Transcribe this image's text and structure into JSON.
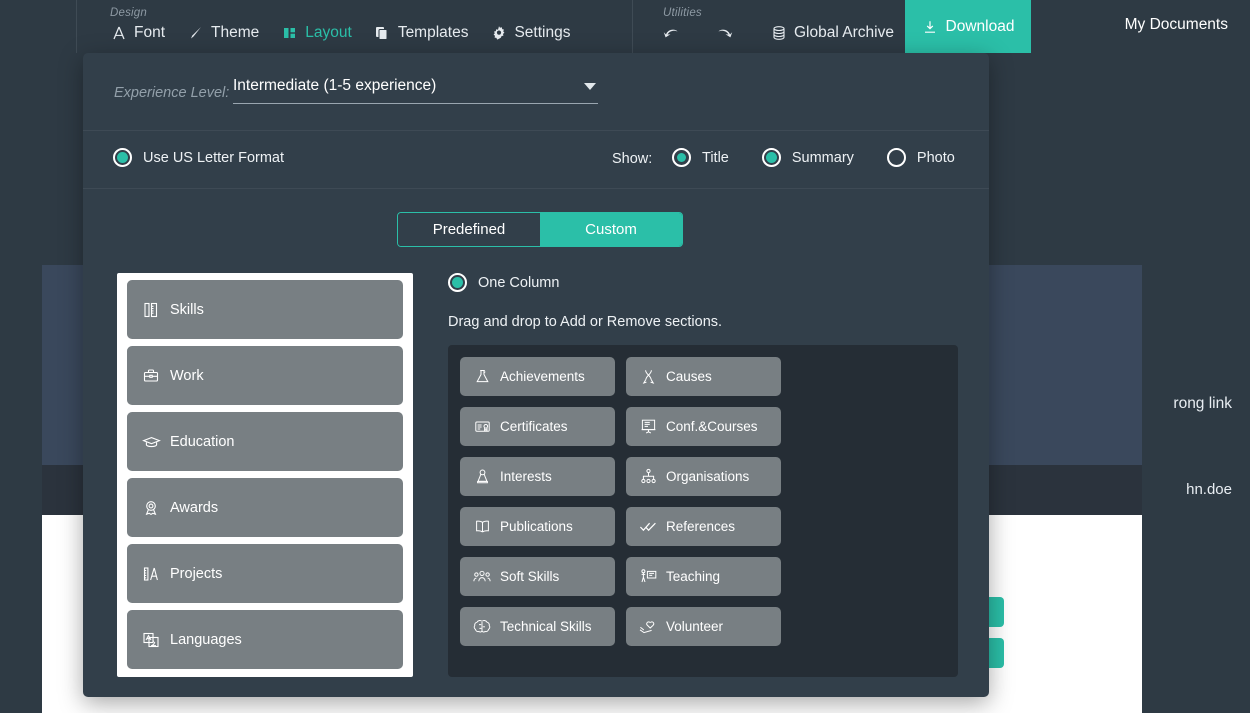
{
  "toolbar": {
    "groups": [
      {
        "label": "Design",
        "items": [
          {
            "label": "Font",
            "icon": "font-icon",
            "active": false
          },
          {
            "label": "Theme",
            "icon": "brush-icon",
            "active": false
          },
          {
            "label": "Layout",
            "icon": "layout-icon",
            "active": true
          },
          {
            "label": "Templates",
            "icon": "templates-icon",
            "active": false
          },
          {
            "label": "Settings",
            "icon": "gear-icon",
            "active": false
          }
        ]
      },
      {
        "label": "Utilities",
        "items": [
          {
            "label": "",
            "icon": "undo-icon",
            "active": false
          },
          {
            "label": "",
            "icon": "redo-icon",
            "active": false
          },
          {
            "label": "Global Archive",
            "icon": "database-icon",
            "active": false
          }
        ]
      }
    ],
    "download_label": "Download",
    "download_icon": "download-icon",
    "my_documents_label": "My Documents",
    "accent_color": "#2bbfa8"
  },
  "modal": {
    "experience": {
      "label": "Experience Level:",
      "value": "Intermediate (1-5 experience)"
    },
    "us_letter": {
      "label": "Use US Letter Format",
      "selected": true
    },
    "show": {
      "label": "Show:",
      "options": [
        {
          "label": "Title",
          "selected": true,
          "style": "gap"
        },
        {
          "label": "Summary",
          "selected": true,
          "style": "full"
        },
        {
          "label": "Photo",
          "selected": false,
          "style": "off"
        }
      ]
    },
    "tabs": [
      {
        "label": "Predefined",
        "active": false
      },
      {
        "label": "Custom",
        "active": true
      }
    ],
    "column_option": {
      "label": "One Column",
      "selected": true
    },
    "drag_hint": "Drag and drop to Add or Remove sections.",
    "active_sections": [
      {
        "label": "Skills",
        "icon": "skills-icon"
      },
      {
        "label": "Work",
        "icon": "briefcase-icon"
      },
      {
        "label": "Education",
        "icon": "graduation-cap-icon"
      },
      {
        "label": "Awards",
        "icon": "award-rosette-icon"
      },
      {
        "label": "Projects",
        "icon": "projects-icon"
      },
      {
        "label": "Languages",
        "icon": "translate-icon"
      }
    ],
    "available_sections": [
      {
        "label": "Achievements",
        "icon": "flask-icon"
      },
      {
        "label": "Causes",
        "icon": "ribbon-icon"
      },
      {
        "label": "Certificates",
        "icon": "certificate-icon"
      },
      {
        "label": "Conf.&Courses",
        "icon": "presentation-icon"
      },
      {
        "label": "Interests",
        "icon": "chess-pawn-icon"
      },
      {
        "label": "Organisations",
        "icon": "org-chart-icon"
      },
      {
        "label": "Publications",
        "icon": "open-book-icon"
      },
      {
        "label": "References",
        "icon": "double-check-icon"
      },
      {
        "label": "Soft Skills",
        "icon": "people-icon"
      },
      {
        "label": "Teaching",
        "icon": "teacher-icon"
      },
      {
        "label": "Technical Skills",
        "icon": "brain-icon"
      },
      {
        "label": "Volunteer",
        "icon": "hand-heart-icon"
      }
    ]
  },
  "background": {
    "card_text": "rong link",
    "strip_text": "hn.doe"
  }
}
